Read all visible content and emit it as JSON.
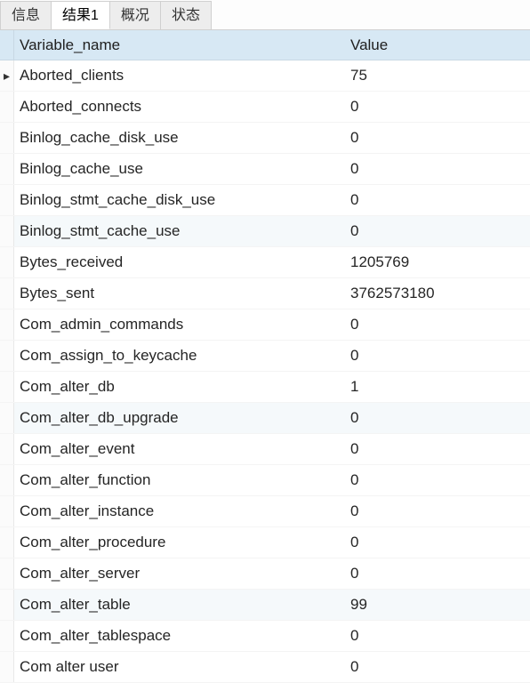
{
  "tabs": [
    {
      "label": "信息",
      "active": false
    },
    {
      "label": "结果1",
      "active": true
    },
    {
      "label": "概况",
      "active": false
    },
    {
      "label": "状态",
      "active": false
    }
  ],
  "columns": {
    "name": "Variable_name",
    "value": "Value"
  },
  "rows": [
    {
      "name": "Aborted_clients",
      "value": "75",
      "current": true
    },
    {
      "name": "Aborted_connects",
      "value": "0"
    },
    {
      "name": "Binlog_cache_disk_use",
      "value": "0"
    },
    {
      "name": "Binlog_cache_use",
      "value": "0"
    },
    {
      "name": "Binlog_stmt_cache_disk_use",
      "value": "0"
    },
    {
      "name": "Binlog_stmt_cache_use",
      "value": "0",
      "alt": true
    },
    {
      "name": "Bytes_received",
      "value": "1205769"
    },
    {
      "name": "Bytes_sent",
      "value": "3762573180"
    },
    {
      "name": "Com_admin_commands",
      "value": "0"
    },
    {
      "name": "Com_assign_to_keycache",
      "value": "0"
    },
    {
      "name": "Com_alter_db",
      "value": "1"
    },
    {
      "name": "Com_alter_db_upgrade",
      "value": "0",
      "alt": true
    },
    {
      "name": "Com_alter_event",
      "value": "0"
    },
    {
      "name": "Com_alter_function",
      "value": "0"
    },
    {
      "name": "Com_alter_instance",
      "value": "0"
    },
    {
      "name": "Com_alter_procedure",
      "value": "0"
    },
    {
      "name": "Com_alter_server",
      "value": "0"
    },
    {
      "name": "Com_alter_table",
      "value": "99",
      "alt": true
    },
    {
      "name": "Com_alter_tablespace",
      "value": "0"
    },
    {
      "name": "Com alter user",
      "value": "0"
    }
  ],
  "indicator": "▸"
}
